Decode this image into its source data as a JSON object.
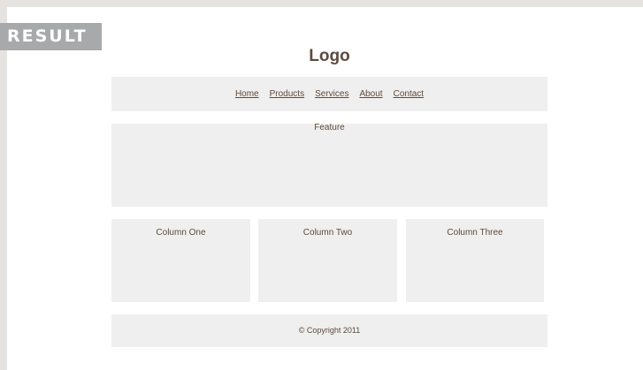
{
  "result_label": "RESULT",
  "logo": "Logo",
  "nav": {
    "items": [
      "Home",
      "Products",
      "Services",
      "About",
      "Contact"
    ]
  },
  "feature": "Feature",
  "columns": [
    "Column One",
    "Column Two",
    "Column Three"
  ],
  "footer": "© Copyright 2011",
  "colors": {
    "background": "#e6e2df",
    "panel": "#eeefee",
    "text": "#5e4a3d",
    "tag": "#a7a9ab"
  }
}
